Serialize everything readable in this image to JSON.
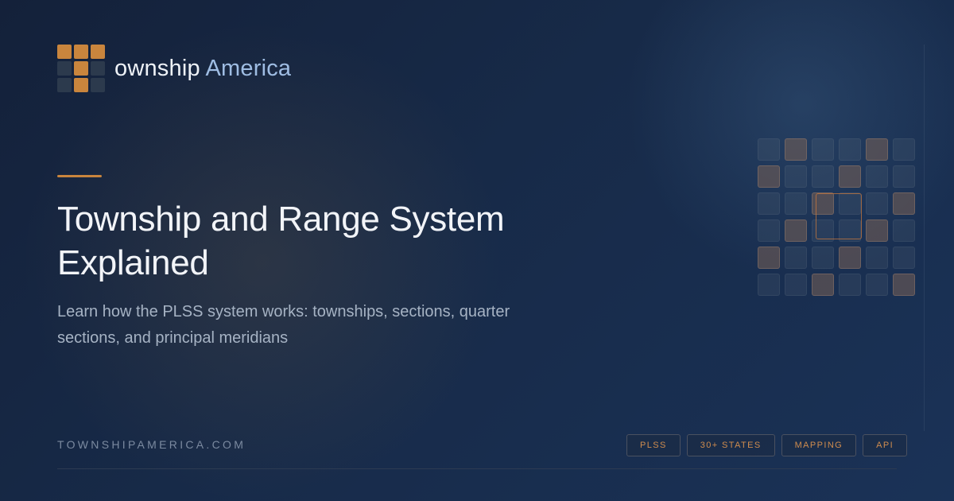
{
  "brand": {
    "logo_text_main": "ownship",
    "logo_text_accent": "America",
    "logo_icon": "township-grid-icon",
    "colors": {
      "orange": "#c9853d",
      "slate": "#2c3a4d",
      "accent_blue": "#9fbde3"
    }
  },
  "hero": {
    "title": "Township and Range System Explained",
    "subtitle": "Learn how the PLSS system works: townships, sections, quarter sections, and principal meridians"
  },
  "footer": {
    "domain": "TOWNSHIPAMERICA.COM",
    "tags": [
      "PLSS",
      "30+ STATES",
      "MAPPING",
      "API"
    ]
  },
  "decor": {
    "icon": "section-grid-icon"
  }
}
